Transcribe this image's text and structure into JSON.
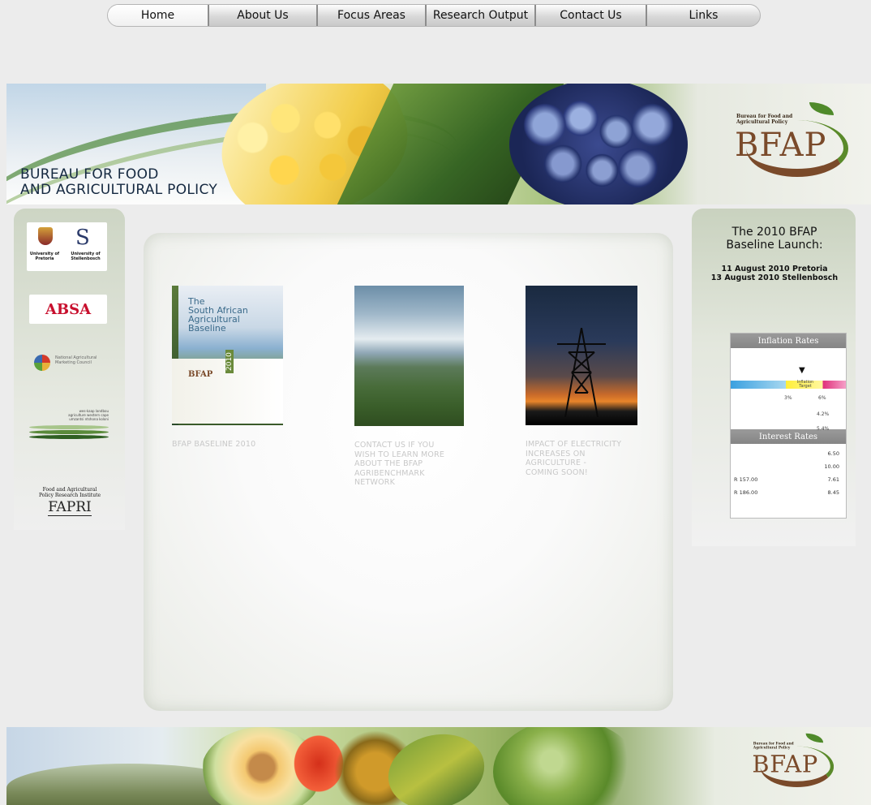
{
  "nav": {
    "items": [
      "Home",
      "About Us",
      "Focus Areas",
      "Research Output",
      "Contact Us",
      "Links"
    ]
  },
  "banner": {
    "title_line1": "BUREAU FOR FOOD",
    "title_line2": "AND AGRICULTURAL POLICY",
    "logo_small_line1": "Bureau for Food and",
    "logo_small_line2": "Agricultural Policy",
    "logo_big": "BFAP"
  },
  "sponsors": {
    "up_label_line1": "University of",
    "up_label_line2": "Pretoria",
    "us_label_line1": "University of",
    "us_label_line2": "Stellenbosch",
    "us_letter": "S",
    "absa": "ABSA",
    "namc_line1": "National Agricultural",
    "namc_line2": "Marketing Council",
    "wc_line1": "wes-kaap landbou",
    "wc_line2": "agriculture western cape",
    "wc_line3": "umzantsi ntshona koloni",
    "fapri_line1": "Food and Agricultural",
    "fapri_line2": "Policy Research Institute",
    "fapri_big": "FAPRI"
  },
  "cards": [
    {
      "book_title": [
        "The",
        "South African",
        "Agricultural",
        "Baseline"
      ],
      "book_logo": "BFAP",
      "book_year": "2010",
      "caption": [
        "BFAP BASELINE 2010"
      ]
    },
    {
      "caption": [
        "CONTACT US IF YOU",
        "WISH TO LEARN MORE",
        "ABOUT THE BFAP",
        "AGRIBENCHMARK",
        "NETWORK"
      ]
    },
    {
      "caption": [
        "IMPACT OF ELECTRICITY",
        "INCREASES ON",
        "AGRICULTURE  -",
        "COMING SOON!"
      ]
    }
  ],
  "launch": {
    "title_line1": "The 2010 BFAP",
    "title_line2": "Baseline Launch:",
    "date_line1": "11 August 2010 Pretoria",
    "date_line2": "13 August 2010 Stellenbosch"
  },
  "rates": {
    "inflation_header": "Inflation Rates",
    "target_label_line1": "Inflation",
    "target_label_line2": "Target",
    "low_pct": "3%",
    "high_pct": "6%",
    "value1": "4.2%",
    "value2": "5.4%",
    "interest_header": "Interest Rates",
    "interest_rows": [
      {
        "left": "",
        "right": "6.50"
      },
      {
        "left": "",
        "right": "10.00"
      },
      {
        "left": "R 157.00",
        "right": "7.61"
      },
      {
        "left": "R 186.00",
        "right": "8.45"
      }
    ]
  },
  "colors": {
    "nav_border": "#8c8c8c",
    "banner_title": "#142840",
    "logo_brown": "#7a4a2a",
    "logo_green": "#5a8a2a",
    "absa_red": "#c8102e",
    "caption_grey": "#c8c8c8"
  }
}
